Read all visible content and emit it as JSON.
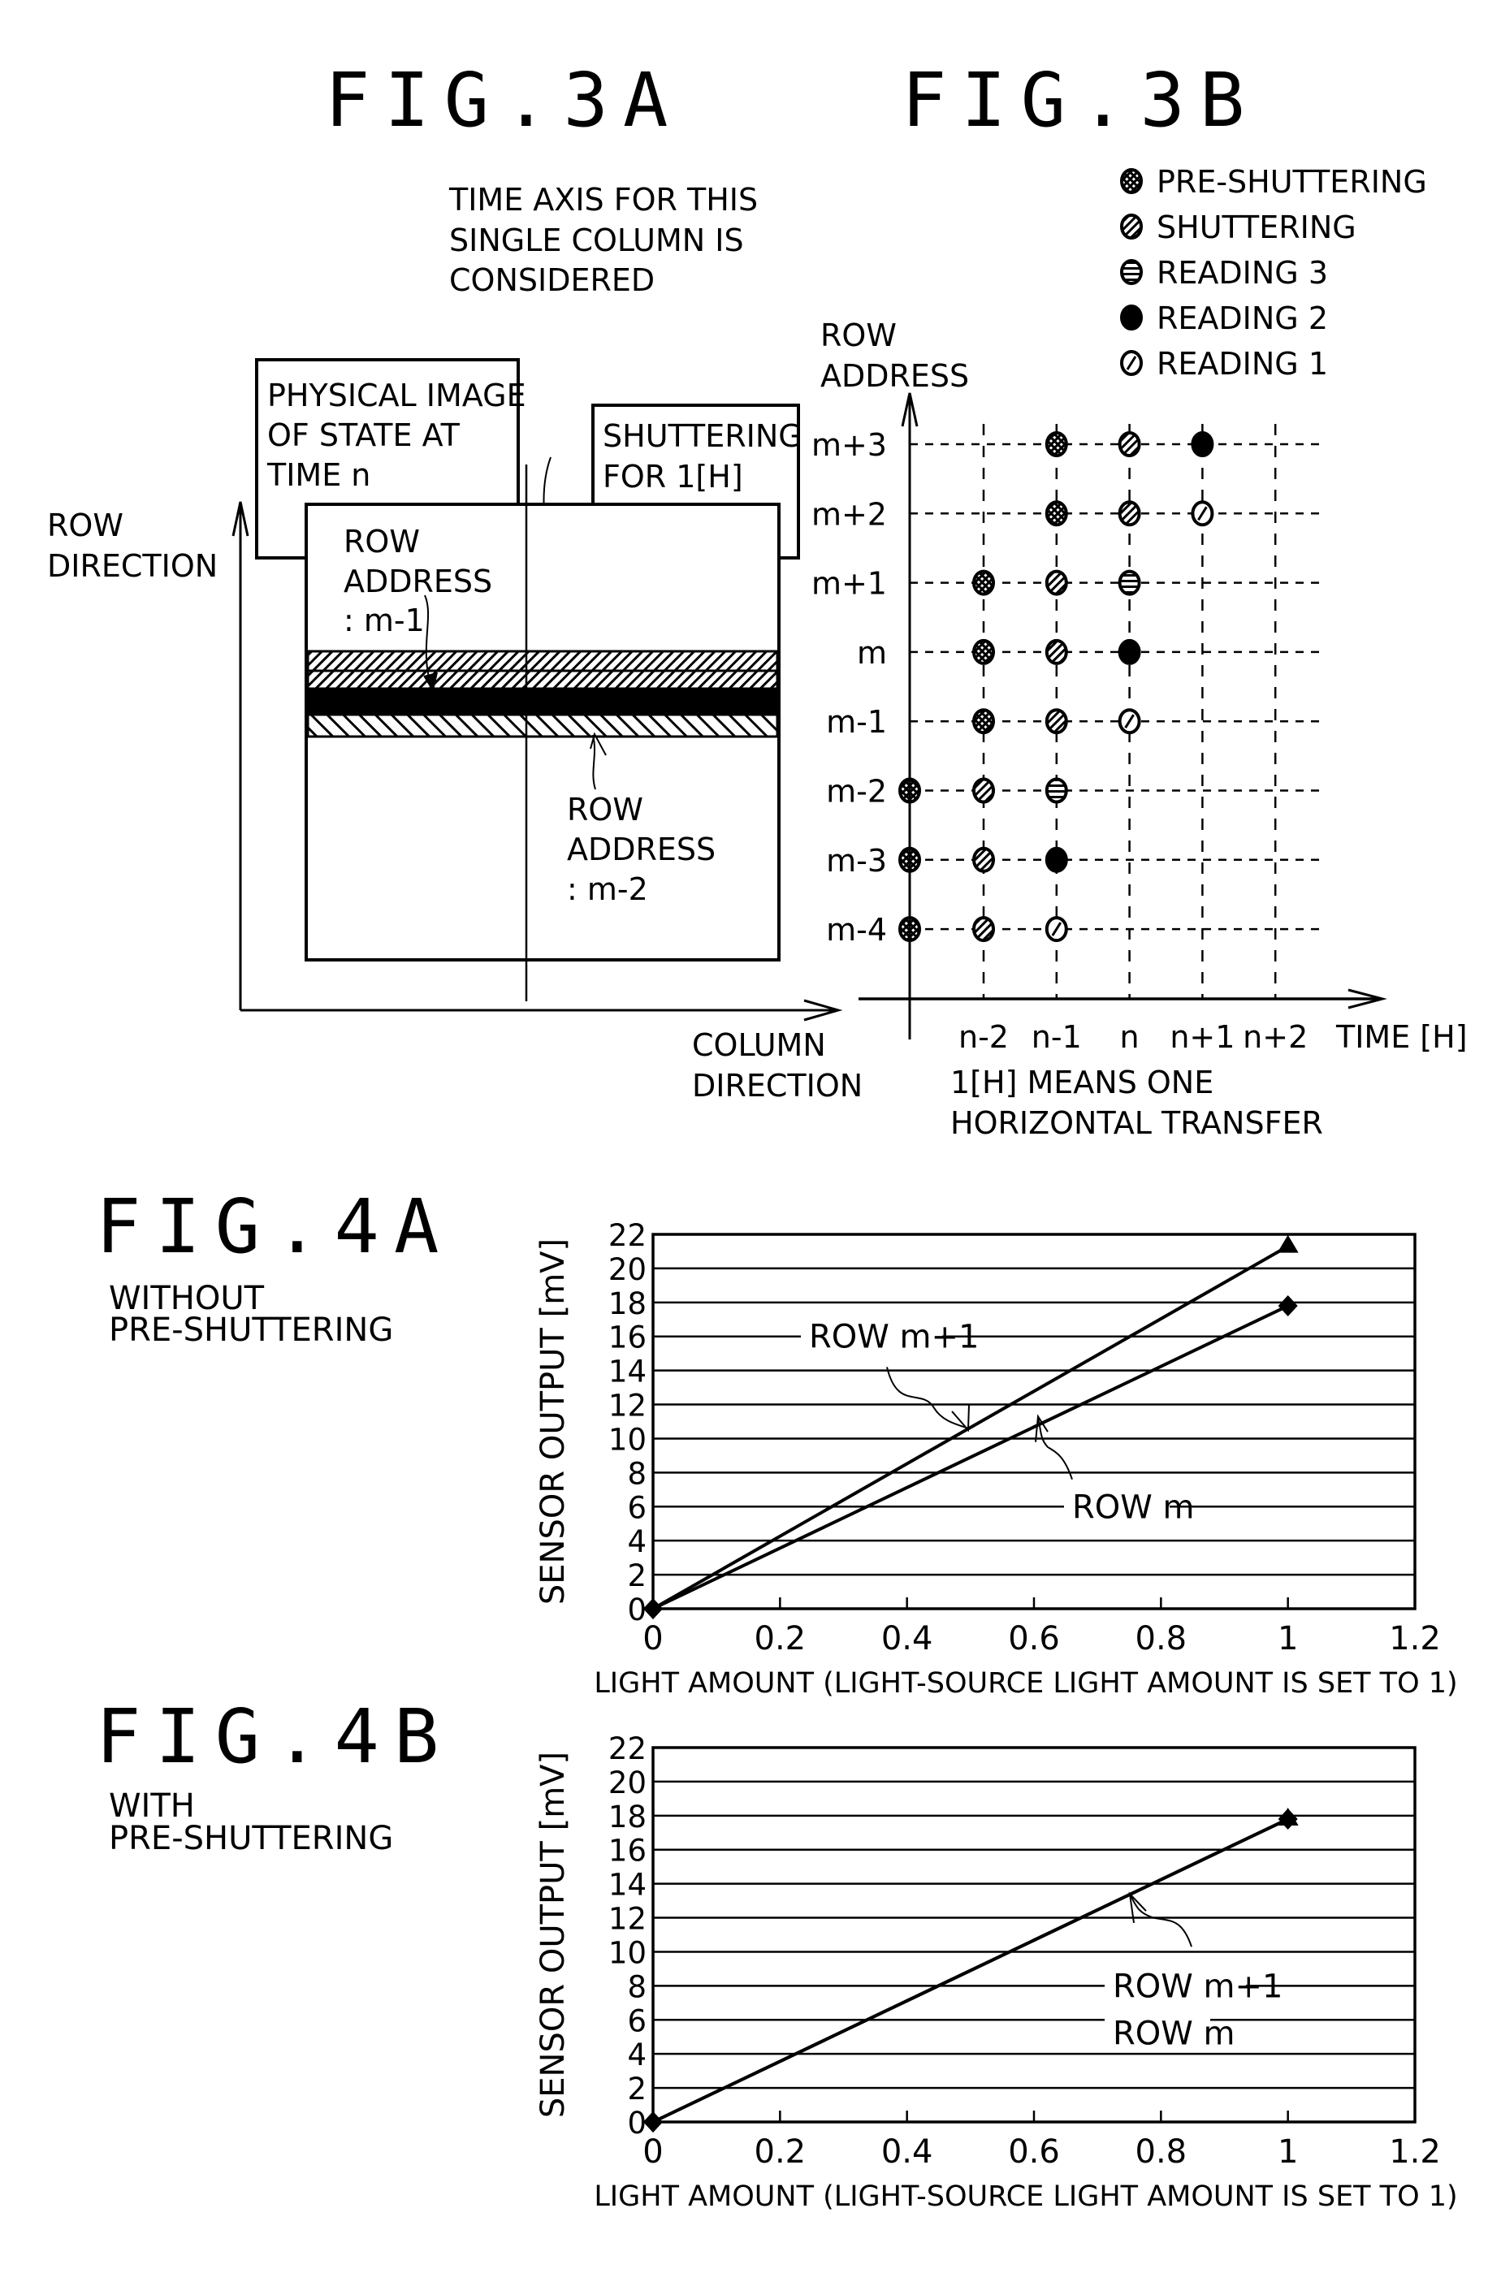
{
  "figures": {
    "fig3a": {
      "title": "FIG.3A",
      "time_axis_note": [
        "TIME AXIS FOR THIS",
        "SINGLE COLUMN IS",
        "CONSIDERED"
      ],
      "physical_image_box": [
        "PHYSICAL IMAGE",
        "OF STATE AT",
        "TIME n"
      ],
      "shuttering_box": [
        "SHUTTERING",
        "FOR 1[H]"
      ],
      "row_direction_label": [
        "ROW",
        "DIRECTION"
      ],
      "column_direction_label": [
        "COLUMN",
        "DIRECTION"
      ],
      "row_address_upper": [
        "ROW",
        "ADDRESS",
        ": m-1"
      ],
      "row_address_lower": [
        "ROW",
        "ADDRESS",
        ": m-2"
      ],
      "bands": [
        "shuttering",
        "shuttering",
        "reading-2",
        "reading-1"
      ]
    },
    "fig3b": {
      "title": "FIG.3B",
      "legend": [
        {
          "key": "pre",
          "label": "PRE-SHUTTERING",
          "icon": "crosshatch-circle-icon"
        },
        {
          "key": "shut",
          "label": "SHUTTERING",
          "icon": "diagonal-hatch-circle-icon"
        },
        {
          "key": "r3",
          "label": "READING 3",
          "icon": "horizontal-stripe-circle-icon"
        },
        {
          "key": "r2",
          "label": "READING 2",
          "icon": "filled-circle-icon"
        },
        {
          "key": "r1",
          "label": "READING 1",
          "icon": "slashed-circle-icon"
        }
      ],
      "y_axis_label": [
        "ROW",
        "ADDRESS"
      ],
      "x_axis_label": "TIME [H]",
      "rows": [
        "m+3",
        "m+2",
        "m+1",
        "m",
        "m-1",
        "m-2",
        "m-3",
        "m-4"
      ],
      "columns": [
        "n-2",
        "n-1",
        "n",
        "n+1",
        "n+2"
      ],
      "note": [
        "1[H] MEANS ONE",
        "HORIZONTAL TRANSFER"
      ],
      "events": [
        {
          "row": "m+3",
          "col": 1,
          "type": "pre"
        },
        {
          "row": "m+3",
          "col": 2,
          "type": "shut"
        },
        {
          "row": "m+3",
          "col": 3,
          "type": "r2"
        },
        {
          "row": "m+2",
          "col": 1,
          "type": "pre"
        },
        {
          "row": "m+2",
          "col": 2,
          "type": "shut"
        },
        {
          "row": "m+2",
          "col": 3,
          "type": "r1"
        },
        {
          "row": "m+1",
          "col": 0,
          "type": "pre"
        },
        {
          "row": "m+1",
          "col": 1,
          "type": "shut"
        },
        {
          "row": "m+1",
          "col": 2,
          "type": "r3"
        },
        {
          "row": "m",
          "col": 0,
          "type": "pre"
        },
        {
          "row": "m",
          "col": 1,
          "type": "shut"
        },
        {
          "row": "m",
          "col": 2,
          "type": "r2"
        },
        {
          "row": "m-1",
          "col": 0,
          "type": "pre"
        },
        {
          "row": "m-1",
          "col": 1,
          "type": "shut"
        },
        {
          "row": "m-1",
          "col": 2,
          "type": "r1"
        },
        {
          "row": "m-2",
          "col": -1,
          "type": "pre"
        },
        {
          "row": "m-2",
          "col": 0,
          "type": "shut"
        },
        {
          "row": "m-2",
          "col": 1,
          "type": "r3"
        },
        {
          "row": "m-3",
          "col": -1,
          "type": "pre"
        },
        {
          "row": "m-3",
          "col": 0,
          "type": "shut"
        },
        {
          "row": "m-3",
          "col": 1,
          "type": "r2"
        },
        {
          "row": "m-4",
          "col": -1,
          "type": "pre"
        },
        {
          "row": "m-4",
          "col": 0,
          "type": "shut"
        },
        {
          "row": "m-4",
          "col": 1,
          "type": "r1"
        }
      ]
    },
    "fig4a": {
      "title": "FIG.4A",
      "condition": [
        "WITHOUT",
        "PRE-SHUTTERING"
      ]
    },
    "fig4b": {
      "title": "FIG.4B",
      "condition": [
        "WITH",
        "PRE-SHUTTERING"
      ]
    }
  },
  "chart_data": [
    {
      "id": "fig4a",
      "type": "line",
      "title": "FIG.4A",
      "subtitle": "WITHOUT PRE-SHUTTERING",
      "xlabel": "LIGHT AMOUNT (LIGHT-SOURCE LIGHT AMOUNT IS SET TO 1)",
      "ylabel": "SENSOR OUTPUT [mV]",
      "xlim": [
        0,
        1.2
      ],
      "ylim": [
        0,
        22
      ],
      "xticks": [
        "0",
        "0.2",
        "0.4",
        "0.6",
        "0.8",
        "1",
        "1.2"
      ],
      "yticks": [
        "0",
        "2",
        "4",
        "6",
        "8",
        "10",
        "12",
        "14",
        "16",
        "18",
        "20",
        "22"
      ],
      "grid": "horizontal",
      "series": [
        {
          "name": "ROW m+1",
          "marker": "triangle",
          "x": [
            0,
            1
          ],
          "y": [
            0,
            21.3
          ]
        },
        {
          "name": "ROW m",
          "marker": "diamond",
          "x": [
            0,
            1
          ],
          "y": [
            0,
            17.8
          ]
        }
      ],
      "annotations": [
        {
          "text": "ROW m+1",
          "series": "ROW m+1",
          "at_x": 0.5
        },
        {
          "text": "ROW m",
          "series": "ROW m",
          "at_x": 0.64
        }
      ]
    },
    {
      "id": "fig4b",
      "type": "line",
      "title": "FIG.4B",
      "subtitle": "WITH PRE-SHUTTERING",
      "xlabel": "LIGHT AMOUNT (LIGHT-SOURCE LIGHT AMOUNT IS SET TO 1)",
      "ylabel": "SENSOR OUTPUT [mV]",
      "xlim": [
        0,
        1.2
      ],
      "ylim": [
        0,
        22
      ],
      "xticks": [
        "0",
        "0.2",
        "0.4",
        "0.6",
        "0.8",
        "1",
        "1.2"
      ],
      "yticks": [
        "0",
        "2",
        "4",
        "6",
        "8",
        "10",
        "12",
        "14",
        "16",
        "18",
        "20",
        "22"
      ],
      "grid": "horizontal",
      "series": [
        {
          "name": "ROW m+1",
          "marker": "triangle",
          "x": [
            0,
            1
          ],
          "y": [
            0,
            17.8
          ]
        },
        {
          "name": "ROW m",
          "marker": "diamond",
          "x": [
            0,
            1
          ],
          "y": [
            0,
            17.8
          ]
        }
      ],
      "annotations": [
        {
          "text": "ROW m+1",
          "series": "ROW m+1",
          "at_x": 0.75
        },
        {
          "text": "ROW m",
          "series": "ROW m",
          "at_x": 0.75
        }
      ]
    }
  ]
}
